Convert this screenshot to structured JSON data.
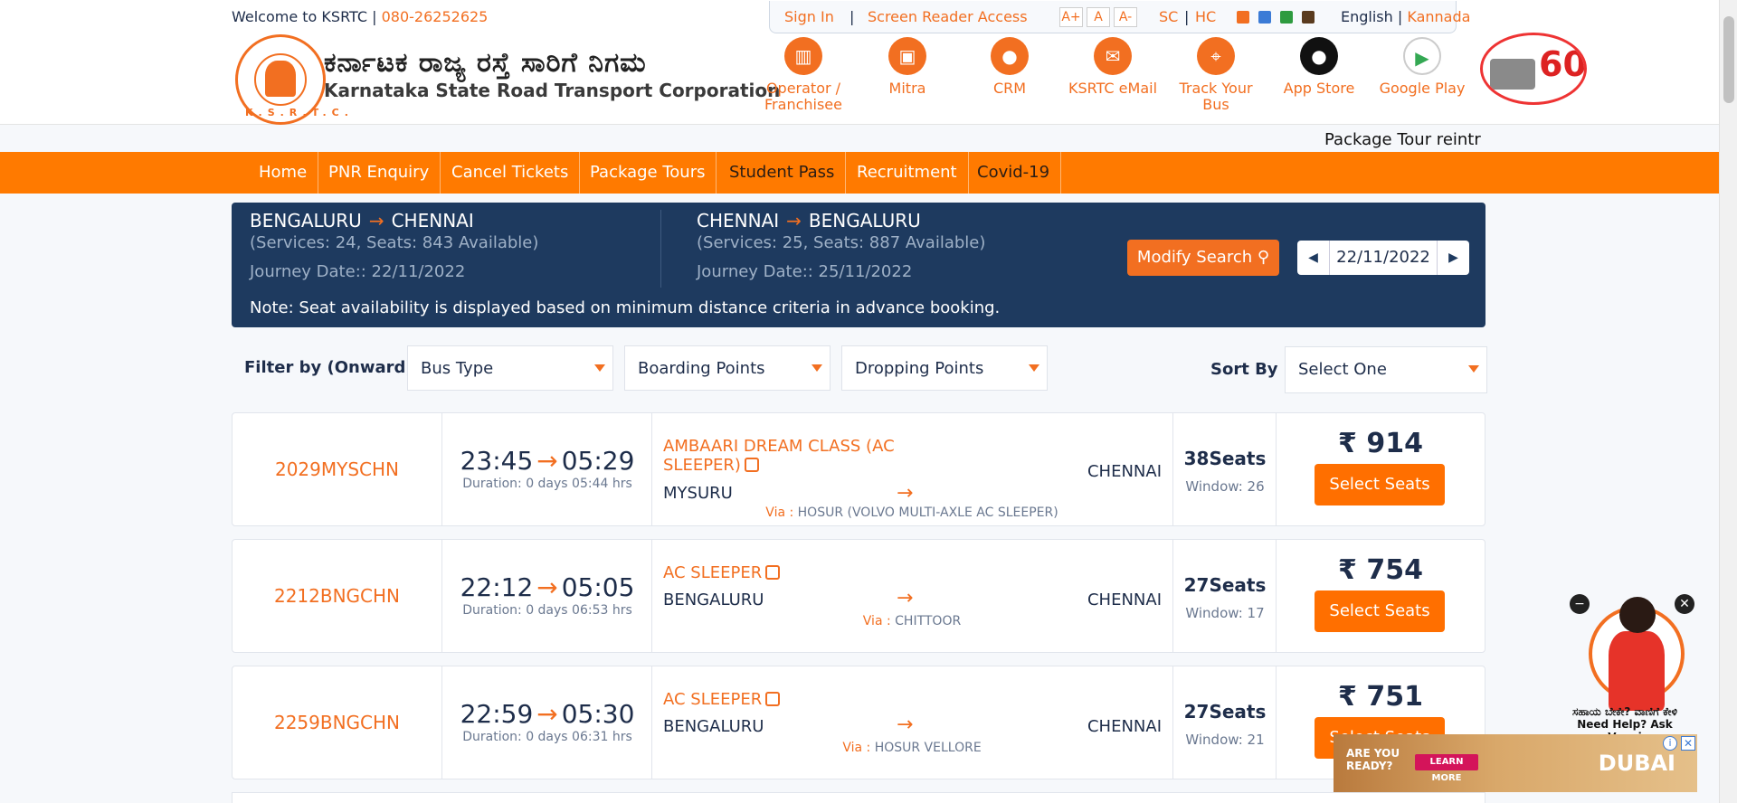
{
  "header": {
    "welcome": "Welcome to KSRTC |",
    "phone": "080-26252625",
    "org_kannada": "ಕರ್ನಾಟಕ ರಾಜ್ಯ ರಸ್ತೆ ಸಾರಿಗೆ ನಿಗಮ",
    "org_english": "Karnataka State Road Transport Corporation",
    "logo_letters": "K.S.R.T.C."
  },
  "utility": {
    "sign_in": "Sign In",
    "sep": "|",
    "screen_reader": "Screen Reader Access",
    "font_up": "A+",
    "font_normal": "A",
    "font_down": "A-",
    "sc": "SC",
    "hc": "HC",
    "sep2": "|",
    "swatch_colors": [
      "#f26f21",
      "#3b7bd6",
      "#2e9b3f",
      "#5a3b1e"
    ],
    "lang_english": "English",
    "lang_sep": "|",
    "lang_kannada": "Kannada"
  },
  "quick_links": [
    {
      "label": "Operator / Franchisee",
      "icon": "building-icon"
    },
    {
      "label": "Mitra",
      "icon": "bus-icon"
    },
    {
      "label": "CRM",
      "icon": "user-icon"
    },
    {
      "label": "KSRTC eMail",
      "icon": "mail-icon"
    },
    {
      "label": "Track Your Bus",
      "icon": "location-icon"
    },
    {
      "label": "App Store",
      "icon": "apple-icon"
    },
    {
      "label": "Google Play",
      "icon": "play-icon"
    }
  ],
  "ticker": "Package Tour reintr",
  "nav": [
    "Home",
    "PNR Enquiry",
    "Cancel Tickets",
    "Package Tours",
    "Student Pass",
    "Recruitment",
    "Covid-19"
  ],
  "search": {
    "onward": {
      "from": "BENGALURU",
      "to": "CHENNAI",
      "services": "(Services: 24, Seats: 843 Available)",
      "journey": "Journey Date:: 22/11/2022"
    },
    "return": {
      "from": "CHENNAI",
      "to": "BENGALURU",
      "services": "(Services: 25, Seats: 887 Available)",
      "journey": "Journey Date:: 25/11/2022"
    },
    "arrow": "→",
    "modify_label": "Modify Search",
    "date": "22/11/2022",
    "note": "Note: Seat availability is displayed based on minimum distance criteria in advance booking."
  },
  "filters": {
    "label": "Filter by (Onward)",
    "bus_type": "Bus Type",
    "boarding": "Boarding Points",
    "dropping": "Dropping Points",
    "sort_label": "Sort By",
    "sort_value": "Select One"
  },
  "results": [
    {
      "service": "2029MYSCHN",
      "dep": "23:45",
      "arr": "05:29",
      "duration": "Duration: 0 days 05:44 hrs",
      "type": "AMBAARI DREAM CLASS (AC SLEEPER)",
      "from": "MYSURU",
      "to": "CHENNAI",
      "via_label": "Via :",
      "via": "HOSUR (VOLVO MULTI-AXLE AC SLEEPER)",
      "seats": "38Seats",
      "window": "Window: 26",
      "price": "₹ 914",
      "select": "Select Seats"
    },
    {
      "service": "2212BNGCHN",
      "dep": "22:12",
      "arr": "05:05",
      "duration": "Duration: 0 days 06:53 hrs",
      "type": "AC SLEEPER",
      "from": "BENGALURU",
      "to": "CHENNAI",
      "via_label": "Via :",
      "via": "CHITTOOR",
      "seats": "27Seats",
      "window": "Window: 17",
      "price": "₹ 754",
      "select": "Select Seats"
    },
    {
      "service": "2259BNGCHN",
      "dep": "22:59",
      "arr": "05:30",
      "duration": "Duration: 0 days 06:31 hrs",
      "type": "AC SLEEPER",
      "from": "BENGALURU",
      "to": "CHENNAI",
      "via_label": "Via :",
      "via": "HOSUR VELLORE",
      "seats": "27Seats",
      "window": "Window: 21",
      "price": "₹ 751",
      "select": "Select Seats"
    }
  ],
  "vaani": {
    "caption1": "ಸಹಾಯ ಬೇಕೇ? ವಾಣಿಗೆ ಕೇಳಿ",
    "caption2": "Need Help? Ask Vaani"
  },
  "ad": {
    "line1": "ARE YOU",
    "line2": "READY?",
    "cta": "LEARN MORE",
    "brand": "DUBAI"
  }
}
